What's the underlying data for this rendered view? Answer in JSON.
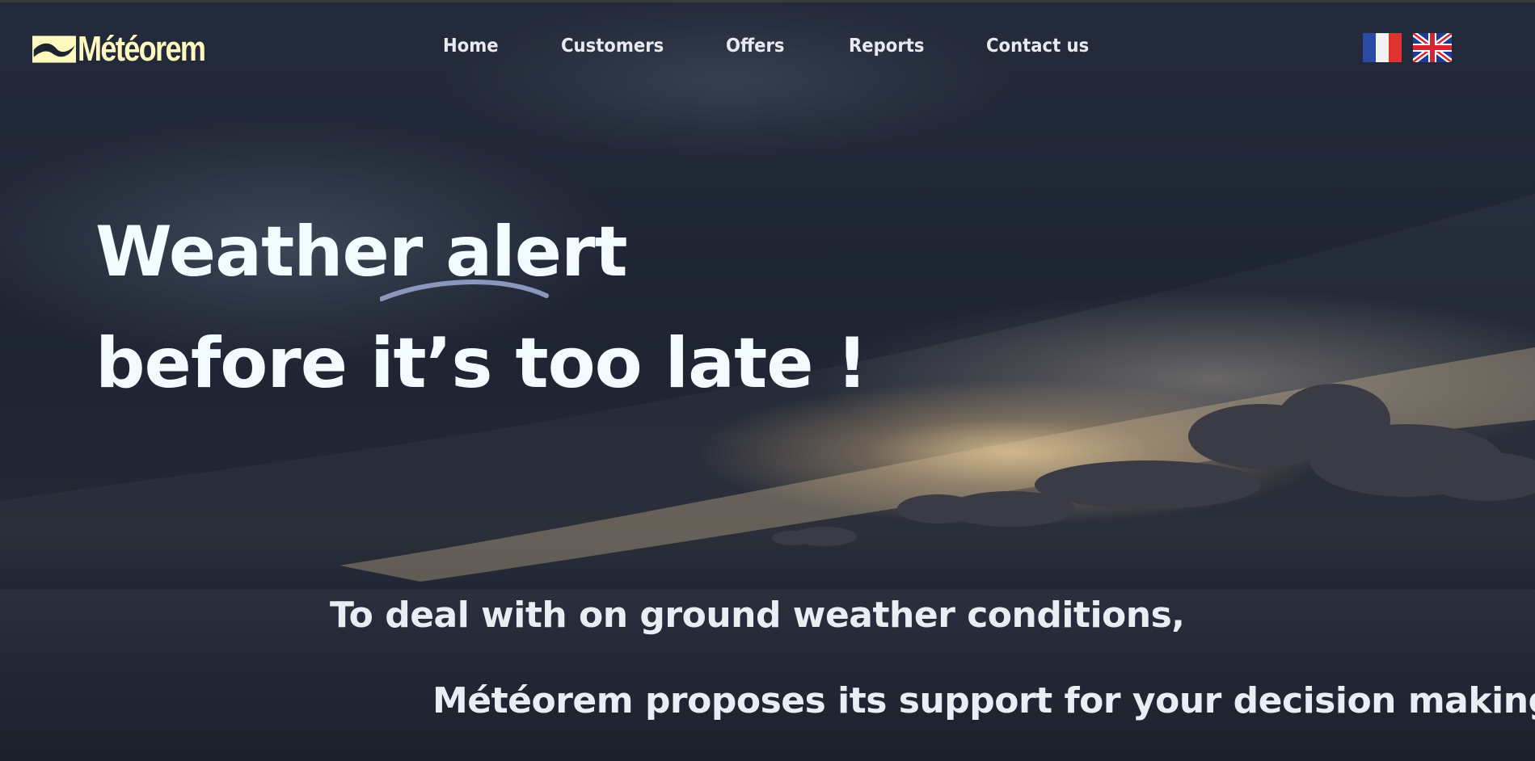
{
  "brand": {
    "name": "Météorem",
    "logo_icon": "wave-icon",
    "color": "#fff9bf"
  },
  "nav": {
    "items": [
      {
        "label": "Home"
      },
      {
        "label": "Customers"
      },
      {
        "label": "Offers"
      },
      {
        "label": "Reports"
      },
      {
        "label": "Contact us"
      }
    ]
  },
  "languages": [
    {
      "name": "French",
      "icon": "flag-fr-icon"
    },
    {
      "name": "English",
      "icon": "flag-uk-icon"
    }
  ],
  "hero": {
    "headline_word1": "Weather",
    "headline_word2": "alert",
    "headline_line2": "before it’s too late !",
    "subline1": "To deal with on ground weather conditions,",
    "subline2": "Météorem proposes its support for your decision making."
  }
}
